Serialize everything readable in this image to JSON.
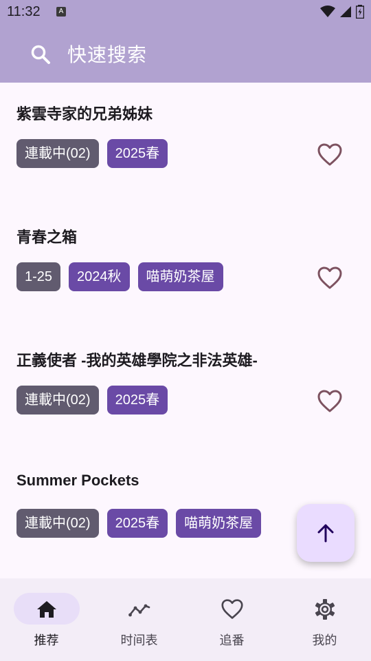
{
  "status_bar": {
    "time": "11:32",
    "notification_letter": "A"
  },
  "search": {
    "placeholder": "快速搜索"
  },
  "list": {
    "items": [
      {
        "title": "紫雲寺家的兄弟姊妹",
        "tags": [
          {
            "label": "連載中(02)",
            "kind": "status"
          },
          {
            "label": "2025春",
            "kind": "season"
          }
        ],
        "favorited": false
      },
      {
        "title": "青春之箱",
        "tags": [
          {
            "label": "1-25",
            "kind": "status"
          },
          {
            "label": "2024秋",
            "kind": "season"
          },
          {
            "label": "喵萌奶茶屋",
            "kind": "group"
          }
        ],
        "favorited": false
      },
      {
        "title": "正義使者 -我的英雄學院之非法英雄-",
        "tags": [
          {
            "label": "連載中(02)",
            "kind": "status"
          },
          {
            "label": "2025春",
            "kind": "season"
          }
        ],
        "favorited": false
      },
      {
        "title": "Summer Pockets",
        "tags": [
          {
            "label": "連載中(02)",
            "kind": "status"
          },
          {
            "label": "2025春",
            "kind": "season"
          },
          {
            "label": "喵萌奶茶屋",
            "kind": "group"
          }
        ],
        "favorited": false
      }
    ]
  },
  "fab": {
    "icon": "arrow-up-icon"
  },
  "bottom_nav": {
    "items": [
      {
        "label": "推荐",
        "icon": "home-icon",
        "active": true
      },
      {
        "label": "时间表",
        "icon": "timeline-icon",
        "active": false
      },
      {
        "label": "追番",
        "icon": "heart-icon",
        "active": false
      },
      {
        "label": "我的",
        "icon": "gear-icon",
        "active": false
      }
    ]
  },
  "colors": {
    "header_bg": "#b1a2d0",
    "page_bg": "#fdf7fe",
    "tag_status": "#615b6f",
    "tag_purple": "#6a4aa6",
    "heart_outline": "#7d5260",
    "nav_bg": "#f3edf7",
    "nav_active_pill": "#e8def8",
    "fab_bg": "#eadcff"
  }
}
